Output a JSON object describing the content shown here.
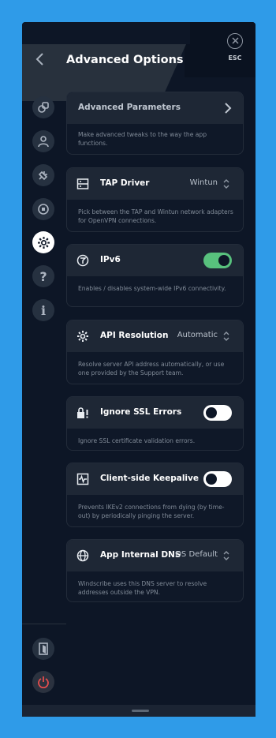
{
  "header": {
    "title": "Advanced Options",
    "esc_label": "ESC",
    "back_icon": "chevron-left-icon",
    "close_icon": "close-icon"
  },
  "sidebar": {
    "items": [
      {
        "icon": "connection-icon"
      },
      {
        "icon": "account-icon"
      },
      {
        "icon": "plug-icon"
      },
      {
        "icon": "robert-icon"
      },
      {
        "icon": "gear-icon",
        "active": true
      },
      {
        "icon": "help-icon"
      },
      {
        "icon": "info-icon"
      }
    ],
    "bottom": [
      {
        "icon": "exit-icon"
      },
      {
        "icon": "power-icon"
      }
    ]
  },
  "cards": {
    "advanced_parameters": {
      "title": "Advanced Parameters",
      "desc": "Make advanced tweaks to the way the app functions."
    },
    "tap_driver": {
      "title": "TAP Driver",
      "value": "Wintun",
      "desc": "Pick between the TAP and Wintun network adapters for OpenVPN connections."
    },
    "ipv6": {
      "title": "IPv6",
      "enabled": true,
      "desc": "Enables / disables system-wide IPv6 connectivity."
    },
    "api_resolution": {
      "title": "API Resolution",
      "value": "Automatic",
      "desc": "Resolve server API address automatically, or use one provided by the Support team."
    },
    "ignore_ssl": {
      "title": "Ignore SSL Errors",
      "enabled": false,
      "desc": "Ignore SSL certificate validation errors."
    },
    "keepalive": {
      "title": "Client-side Keepalive",
      "enabled": false,
      "desc": "Prevents IKEv2 connections from dying (by time-out) by periodically pinging the server."
    },
    "internal_dns": {
      "title": "App Internal DNS",
      "value": "OS Default",
      "desc": "Windscribe uses this DNS server to resolve addresses outside the VPN."
    }
  },
  "colors": {
    "background": "#2f9be8",
    "panel": "#0d1626",
    "card_head": "#1e2735",
    "toggle_on": "#58c17d",
    "power": "#e54d4d"
  }
}
